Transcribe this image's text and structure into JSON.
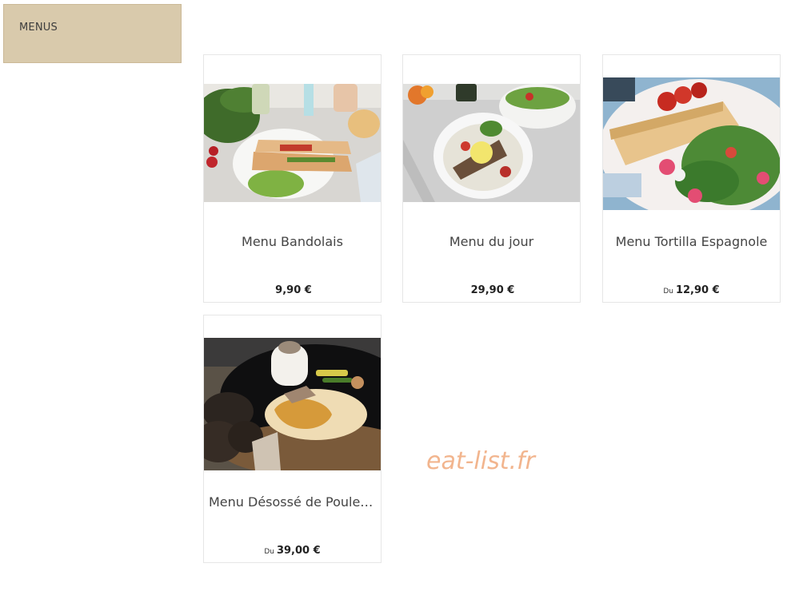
{
  "sidebar": {
    "title": "MENUS"
  },
  "products": [
    {
      "name": "Menu Bandolais",
      "price_prefix": "",
      "price": "9,90 €",
      "image": "sandwich-plate-image"
    },
    {
      "name": "Menu du jour",
      "price_prefix": "",
      "price": "29,90 €",
      "image": "fish-bowl-image"
    },
    {
      "name": "Menu Tortilla Espagnole",
      "price_prefix": "Du",
      "price": "12,90 €",
      "image": "tortilla-salad-image"
    },
    {
      "name": "Menu Désossé de Poulet...",
      "price_prefix": "Du",
      "price": "39,00 €",
      "image": "chicken-rice-image"
    }
  ],
  "watermark": "eat-list.fr",
  "colors": {
    "sidebar_bg": "#d9caac",
    "watermark": "#f2b58e",
    "card_border": "#e6e6e6"
  }
}
